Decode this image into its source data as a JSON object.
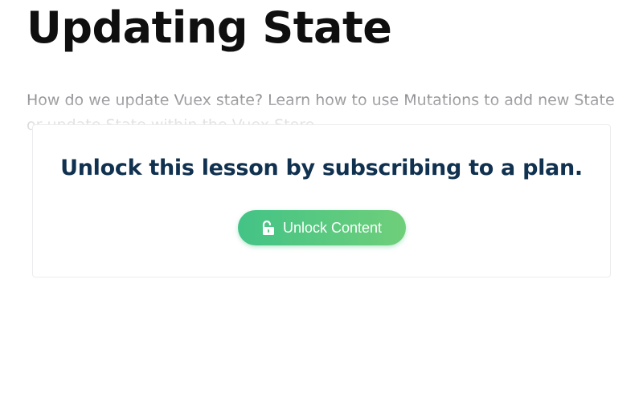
{
  "lesson": {
    "title": "Updating State",
    "description": "How do we update Vuex state? Learn how to use Mutations to add new State or update State within the Vuex Store."
  },
  "paywall": {
    "heading": "Unlock this lesson by subscribing to a plan.",
    "button_label": "Unlock Content",
    "button_icon": "unlock-icon"
  },
  "colors": {
    "title": "#0f0f10",
    "description": "#7d7d82",
    "heading": "#10314f",
    "button_start": "#43c386",
    "button_end": "#6fcf7a",
    "button_text": "#ffffff"
  }
}
